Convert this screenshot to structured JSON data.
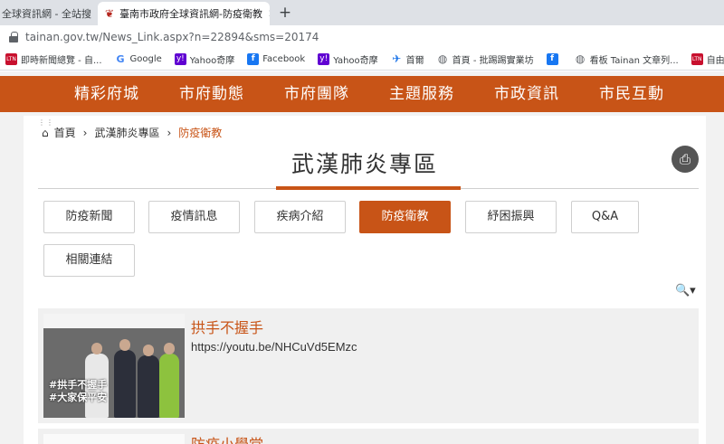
{
  "browser": {
    "tabs": [
      {
        "title": "全球資訊網 - 全站搜"
      },
      {
        "title": "臺南市政府全球資訊網-防疫衛教"
      }
    ],
    "url": "tainan.gov.tw/News_Link.aspx?n=22894&sms=20174",
    "bookmarks": [
      {
        "label": "即時新聞總覽 - 自...",
        "icon": "ltn-icon"
      },
      {
        "label": "Google",
        "icon": "google-icon"
      },
      {
        "label": "Yahoo奇摩",
        "icon": "yahoo-icon"
      },
      {
        "label": "Facebook",
        "icon": "facebook-icon"
      },
      {
        "label": "Yahoo奇摩",
        "icon": "yahoo-icon"
      },
      {
        "label": "首爾",
        "icon": "plane-icon"
      },
      {
        "label": "首頁 - 批踢踢實業坊",
        "icon": "globe-icon"
      },
      {
        "label": "",
        "icon": "facebook-icon"
      },
      {
        "label": "看板 Tainan 文章列...",
        "icon": "globe-icon"
      },
      {
        "label": "自由時報電子報",
        "icon": "ltn-icon"
      }
    ]
  },
  "nav": [
    "精彩府城",
    "市府動態",
    "市府團隊",
    "主題服務",
    "市政資訊",
    "市民互動"
  ],
  "breadcrumb": {
    "home": "首頁",
    "items": [
      "武漢肺炎專區",
      "防疫衛教"
    ]
  },
  "page_title": "武漢肺炎專區",
  "categories": [
    "防疫新聞",
    "疫情訊息",
    "疾病介紹",
    "防疫衛教",
    "紓困振興",
    "Q&A",
    "相關連結"
  ],
  "active_category": "防疫衛教",
  "articles": [
    {
      "title": "拱手不握手",
      "link": "https://youtu.be/NHCuVd5EMzc",
      "thumb_caption_1": "#拱手不握手",
      "thumb_caption_2": "#大家保平安"
    },
    {
      "title": "防疫小學堂"
    }
  ],
  "colors": {
    "brand": "#c85417",
    "nav_text": "#ffffff"
  }
}
